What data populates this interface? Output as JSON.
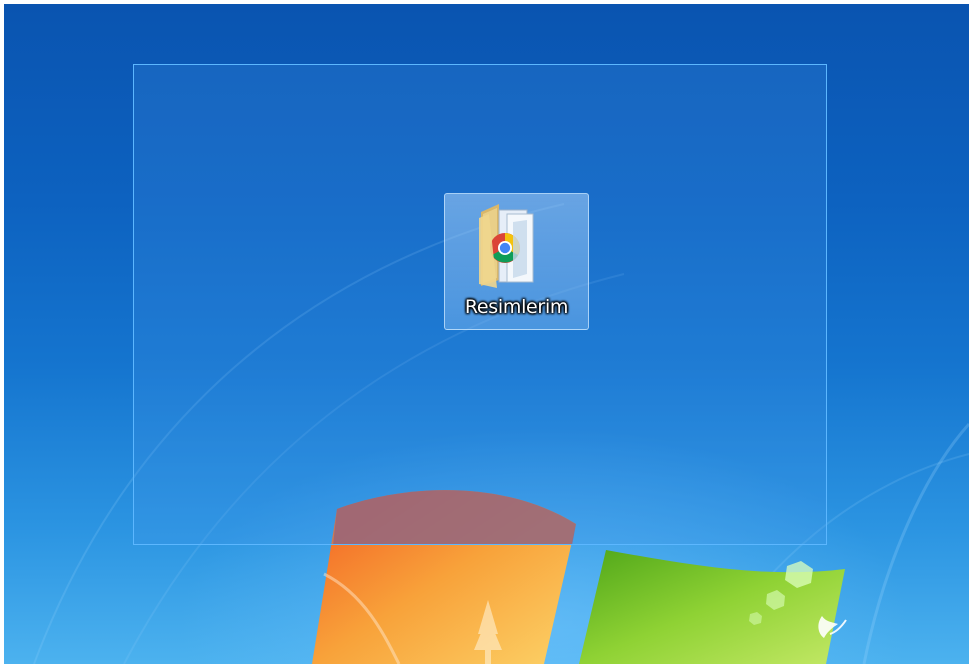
{
  "desktop": {
    "icons": [
      {
        "label": "Resimlerim",
        "icon": "pictures-folder-icon",
        "selected": true
      }
    ],
    "selection_rectangle": true,
    "colors": {
      "background_top": "#0a54b0",
      "background_bottom": "#4cb2ef",
      "selection_border": "#5cb7ff",
      "logo_red": "#e8491e",
      "logo_green": "#6cbf1d"
    },
    "logo": "windows-logo"
  }
}
